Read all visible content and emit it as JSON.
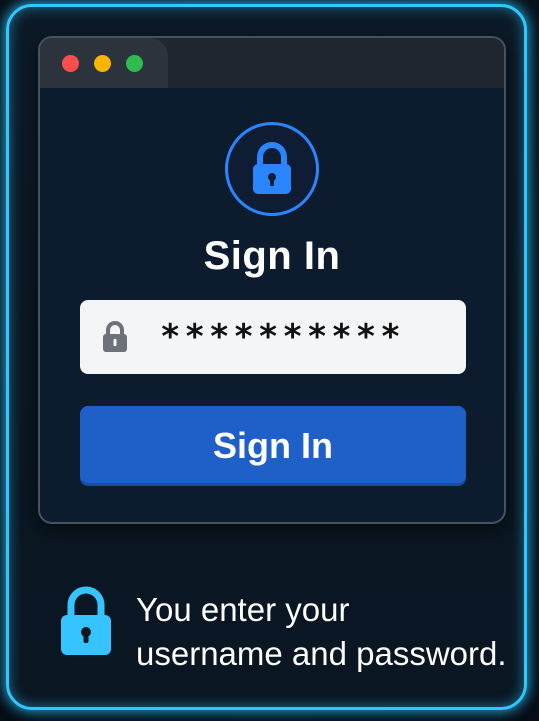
{
  "window": {
    "controls": [
      "close",
      "minimize",
      "maximize"
    ],
    "colors": {
      "close": "#ff4d4f",
      "minimize": "#f7b500",
      "maximize": "#2dbd4e"
    }
  },
  "login": {
    "icon": "lock-icon",
    "heading": "Sign In",
    "password_value": "**********",
    "password_icon": "lock-icon",
    "button_label": "Sign In",
    "accent_color": "#1f5fc8"
  },
  "caption": {
    "icon": "lock-icon",
    "line1": "You enter your",
    "line2": "username and password."
  },
  "theme": {
    "frame_glow": "#2ec8ff",
    "background": "#07121d"
  }
}
